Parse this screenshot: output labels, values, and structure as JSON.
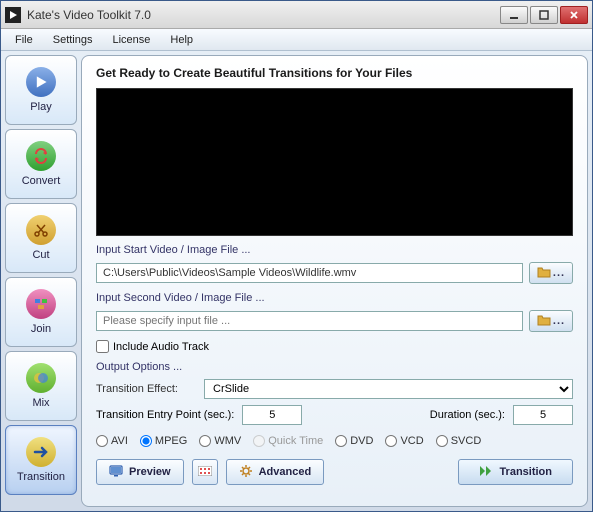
{
  "window": {
    "title": "Kate's Video Toolkit 7.0"
  },
  "menu": {
    "file": "File",
    "settings": "Settings",
    "license": "License",
    "help": "Help"
  },
  "sidebar": {
    "play": "Play",
    "convert": "Convert",
    "cut": "Cut",
    "join": "Join",
    "mix": "Mix",
    "transition": "Transition"
  },
  "panel": {
    "title": "Get Ready to Create Beautiful Transitions for Your Files",
    "input1_label": "Input Start Video / Image File ...",
    "input1_value": "C:\\Users\\Public\\Videos\\Sample Videos\\Wildlife.wmv",
    "input2_label": "Input Second Video / Image File ...",
    "input2_placeholder": "Please specify input file ...",
    "include_audio": "Include Audio Track",
    "output_label": "Output Options ...",
    "effect_label": "Transition Effect:",
    "effect_value": "CrSlide",
    "entry_label": "Transition Entry Point (sec.):",
    "entry_value": "5",
    "duration_label": "Duration (sec.):",
    "duration_value": "5",
    "browse_dots": "...",
    "formats": {
      "avi": "AVI",
      "mpeg": "MPEG",
      "wmv": "WMV",
      "qt": "Quick Time",
      "dvd": "DVD",
      "vcd": "VCD",
      "svcd": "SVCD"
    },
    "actions": {
      "preview": "Preview",
      "advanced": "Advanced",
      "transition": "Transition"
    }
  }
}
